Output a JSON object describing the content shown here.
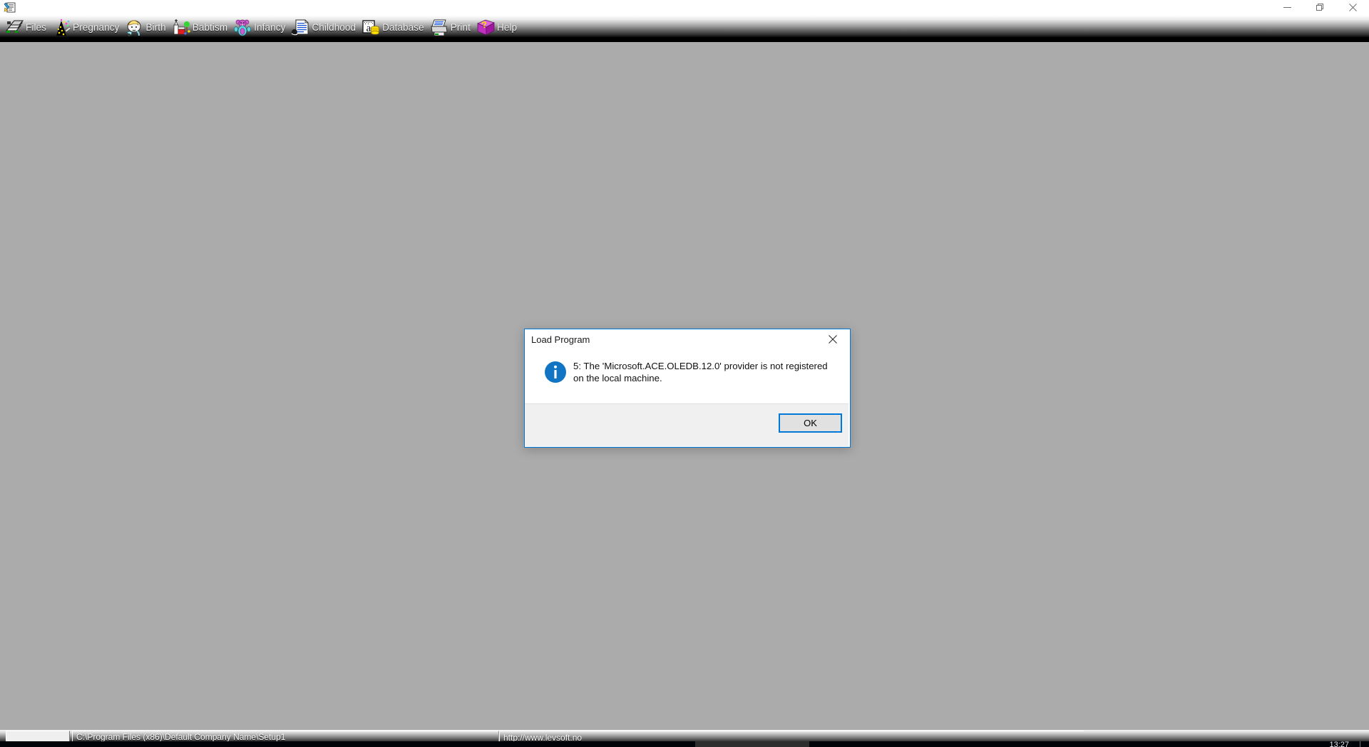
{
  "window": {
    "app_icon": "app-document-pencil-icon",
    "controls": {
      "minimize": "minimize-icon",
      "restore": "restore-icon",
      "close": "close-icon"
    }
  },
  "toolbar": {
    "items": [
      {
        "label": "Files",
        "icon": "files-icon"
      },
      {
        "label": "Pregnancy",
        "icon": "pregnancy-icon"
      },
      {
        "label": "Birth",
        "icon": "birth-icon"
      },
      {
        "label": "Babtism",
        "icon": "babtism-icon"
      },
      {
        "label": "Infancy",
        "icon": "infancy-icon"
      },
      {
        "label": "Childhood",
        "icon": "childhood-icon"
      },
      {
        "label": "Database",
        "icon": "database-icon"
      },
      {
        "label": "Print",
        "icon": "print-icon"
      },
      {
        "label": "Help",
        "icon": "help-icon"
      }
    ]
  },
  "statusbar": {
    "empty_panel": "",
    "path": "C:\\Program Files (x86)\\Default Company Name\\Setup1",
    "url": "http://www.levsoft.no"
  },
  "taskbar": {
    "clock": "13:27"
  },
  "dialog": {
    "title": "Load Program",
    "close_icon": "close-icon",
    "icon": "information-icon",
    "message": "5: The 'Microsoft.ACE.OLEDB.12.0' provider is not registered on the local machine.",
    "ok_label": "OK"
  },
  "colors": {
    "desktop": "#ababab",
    "accent": "#0078d7",
    "dialog_footer": "#f0f0f0",
    "toolbar_text": "#f2f2f2"
  }
}
